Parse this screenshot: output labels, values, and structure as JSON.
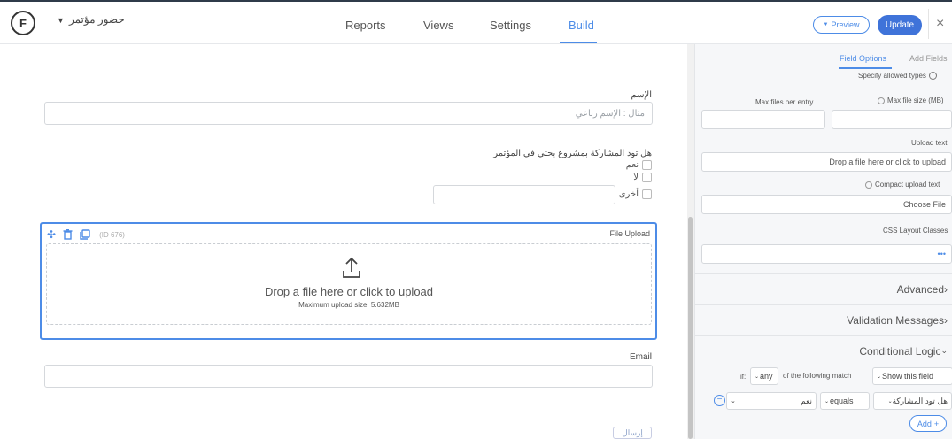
{
  "header": {
    "logo": "F",
    "form_name": "حضور مؤتمر",
    "nav": [
      "Reports",
      "Views",
      "Settings",
      "Build"
    ],
    "preview_label": "Preview",
    "update_label": "Update",
    "close_label": "×"
  },
  "form": {
    "name_label": "الإسم",
    "name_placeholder": "مثال : الإسم رباعي",
    "question_label": "هل تود المشاركة بمشروع بحثي في المؤتمر",
    "options": [
      "نعم",
      "لا",
      "أخرى"
    ],
    "upload": {
      "field_id": "(ID 676)",
      "title": "File Upload",
      "drop_text": "Drop a file here or click to upload",
      "max_size": "Maximum upload size: 5.632MB"
    },
    "email_label": "Email",
    "submit_label": "إرسال"
  },
  "panel": {
    "tabs": [
      "Field Options",
      "Add Fields"
    ],
    "specify_types": "Specify allowed types",
    "max_files_label": "Max files per entry",
    "max_size_label": "Max file size (MB)",
    "upload_text_label": "Upload text",
    "upload_text_value": "Drop a file here or click to upload",
    "compact_label": "Compact upload text",
    "compact_value": "Choose File",
    "css_label": "CSS Layout Classes",
    "css_value": "•••",
    "sections": [
      "Advanced",
      "Validation Messages",
      "Conditional Logic"
    ],
    "logic": {
      "if": "if:",
      "any": "any",
      "match_text": "of the following match",
      "action": "Show this field",
      "field": "هل تود المشاركة",
      "operator": "equals",
      "value": "نعم",
      "add_label": "Add"
    }
  }
}
